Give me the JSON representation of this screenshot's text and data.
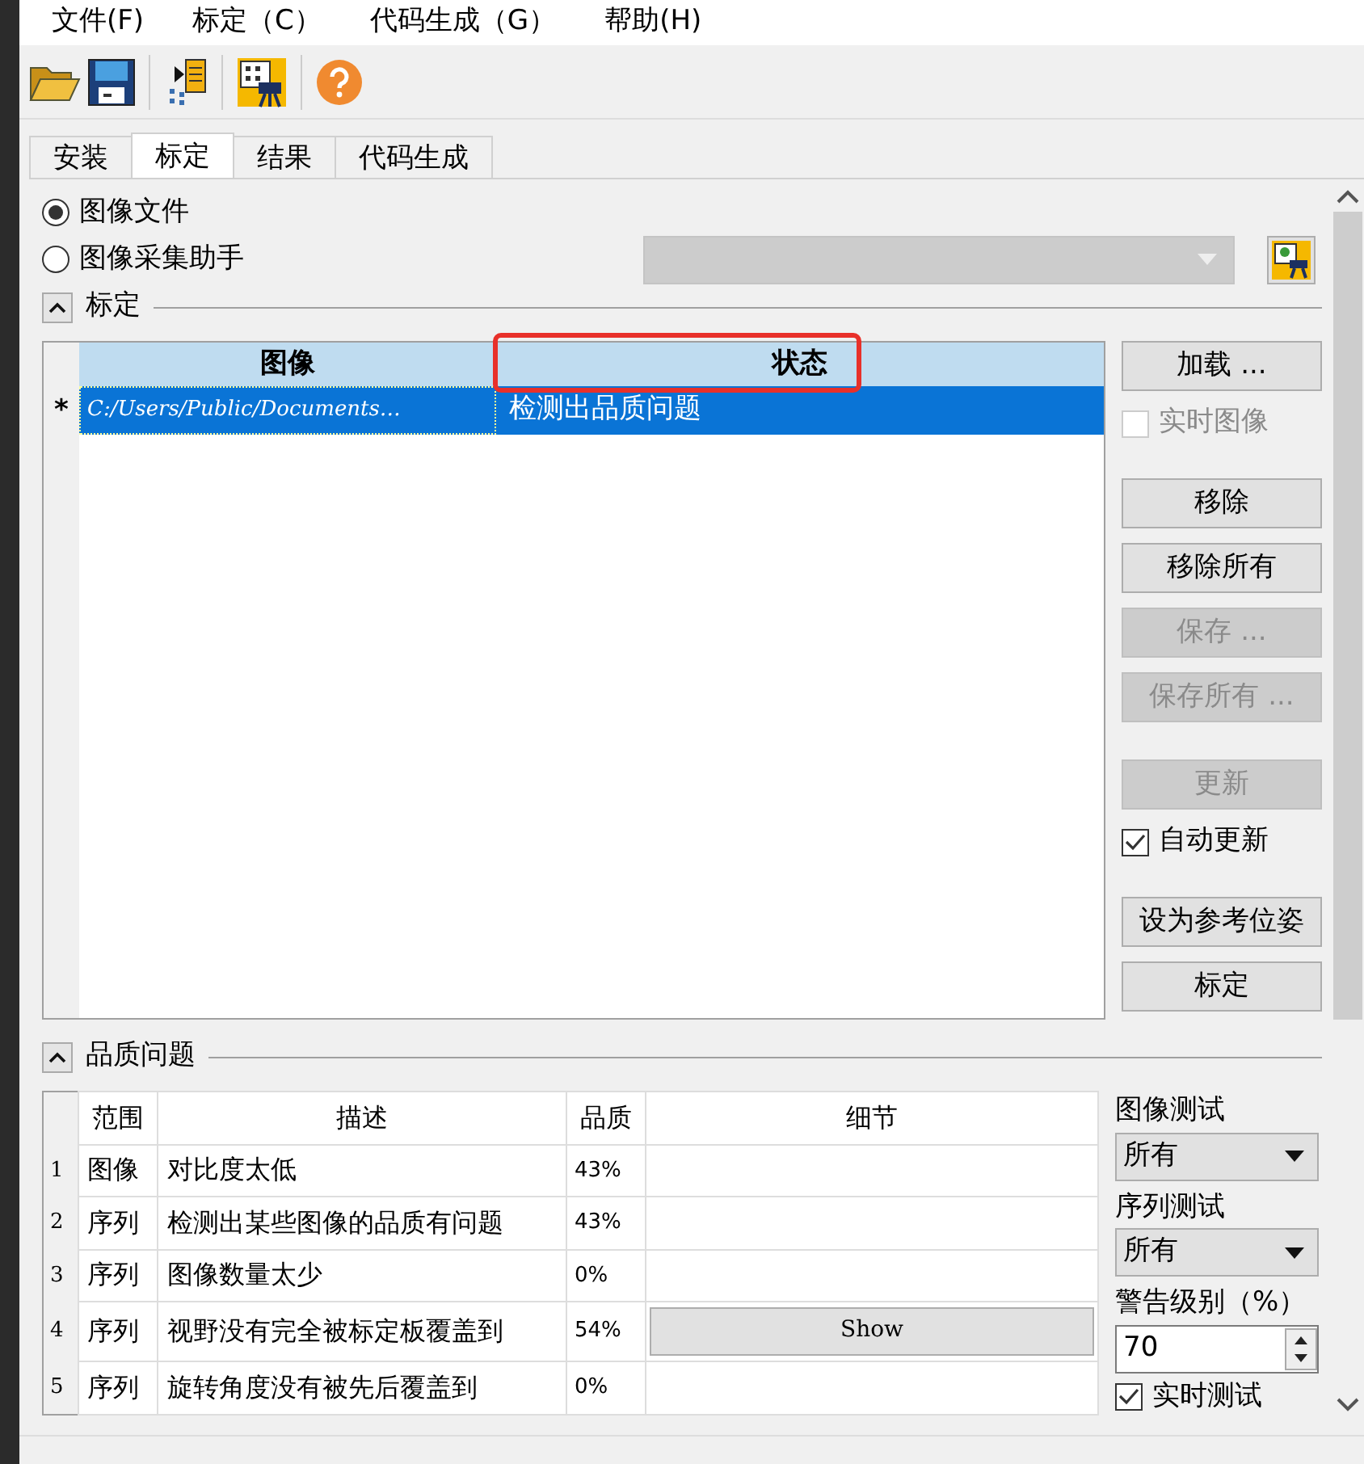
{
  "menu": [
    {
      "label": "文件(F)"
    },
    {
      "label": "标定（C）"
    },
    {
      "label": "代码生成（G）"
    },
    {
      "label": "帮助(H)"
    }
  ],
  "tabs": [
    {
      "label": "安装",
      "selected": false
    },
    {
      "label": "标定",
      "selected": true
    },
    {
      "label": "结果",
      "selected": false
    },
    {
      "label": "代码生成",
      "selected": false
    }
  ],
  "source": [
    {
      "label": "图像文件",
      "selected": true
    },
    {
      "label": "图像采集助手",
      "selected": false
    }
  ],
  "calibration": {
    "title": "标定",
    "expanded": true,
    "columns": [
      "图像",
      "状态"
    ],
    "rows": [
      {
        "marker": "*",
        "image": "C:/Users/Public/Documents…",
        "status": "检测出品质问题",
        "selected": true,
        "highlighted": true
      }
    ],
    "controls": [
      {
        "kind": "button",
        "label": "加载 ...",
        "disabled": false
      },
      {
        "kind": "checkbox",
        "label": "实时图像",
        "checked": false,
        "disabled": true
      },
      {
        "kind": "button",
        "label": "移除",
        "disabled": false,
        "gap": true
      },
      {
        "kind": "button",
        "label": "移除所有",
        "disabled": false
      },
      {
        "kind": "button",
        "label": "保存 ...",
        "disabled": true
      },
      {
        "kind": "button",
        "label": "保存所有 ...",
        "disabled": true
      },
      {
        "kind": "button",
        "label": "更新",
        "disabled": true,
        "gap": true
      },
      {
        "kind": "checkbox",
        "label": "自动更新",
        "checked": true,
        "disabled": false
      },
      {
        "kind": "button",
        "label": "设为参考位姿",
        "disabled": false,
        "gap": true
      },
      {
        "kind": "button",
        "label": "标定",
        "disabled": false
      }
    ]
  },
  "quality": {
    "title": "品质问题",
    "expanded": true,
    "columns": [
      "范围",
      "描述",
      "品质",
      "细节"
    ],
    "rows": [
      {
        "index": "1",
        "scope": "图像",
        "description": "对比度太低",
        "quality": "43%"
      },
      {
        "index": "2",
        "scope": "序列",
        "description": "检测出某些图像的品质有问题",
        "quality": "43%"
      },
      {
        "index": "3",
        "scope": "序列",
        "description": "图像数量太少",
        "quality": "0%"
      },
      {
        "index": "4",
        "scope": "序列",
        "description": "视野没有完全被标定板覆盖到",
        "quality": "54%",
        "detail": "Show"
      },
      {
        "index": "5",
        "scope": "序列",
        "description": "旋转角度没有被先后覆盖到",
        "quality": "0%"
      }
    ],
    "image_test": {
      "label": "图像测试",
      "value": "所有"
    },
    "sequence_test": {
      "label": "序列测试",
      "value": "所有"
    },
    "warning_level": {
      "label": "警告级别（%）",
      "value": "70"
    },
    "realtime_test": {
      "label": "实时测试",
      "checked": true
    }
  }
}
